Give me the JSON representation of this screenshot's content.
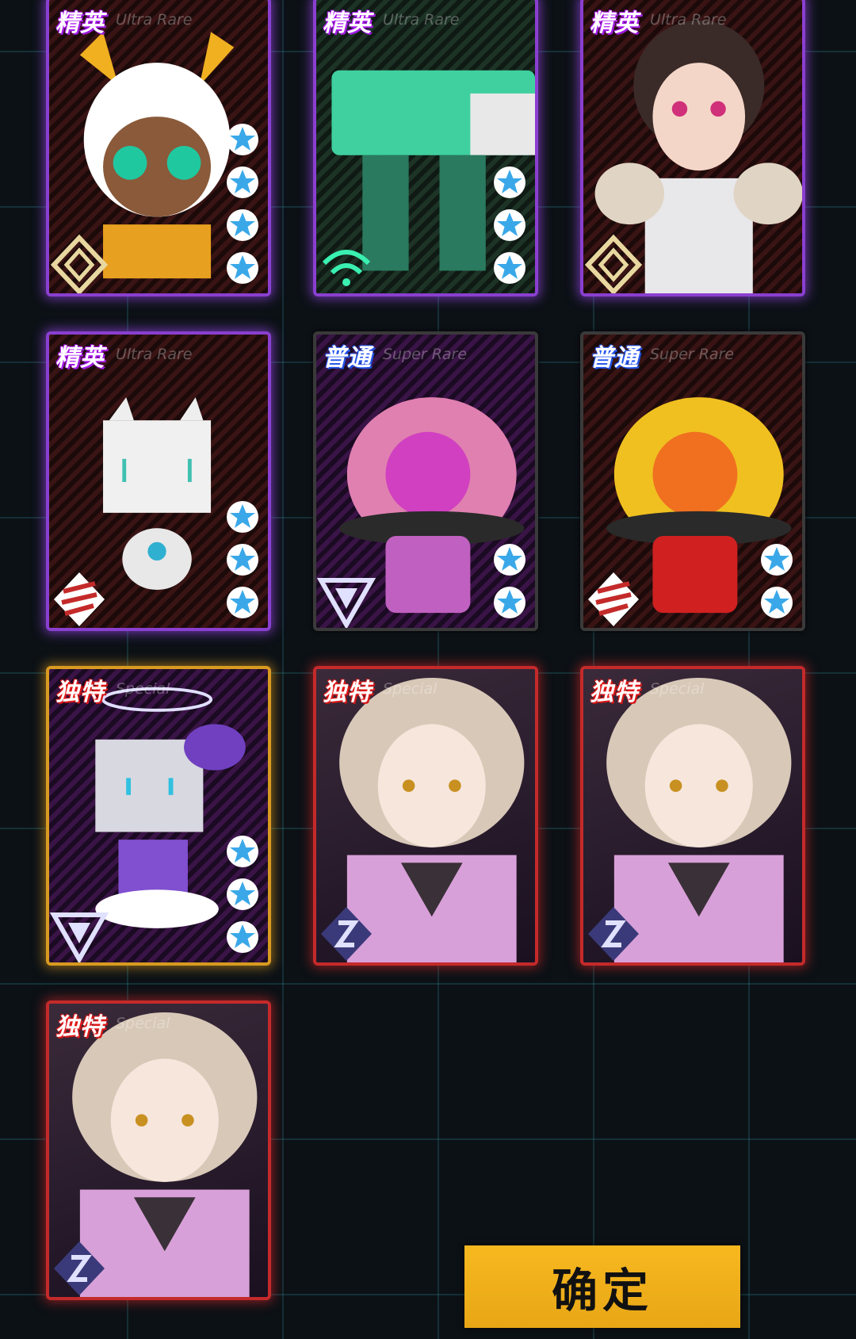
{
  "cards": [
    {
      "rarity_label": "精英",
      "rarity_sub": "Ultra Rare",
      "stars": 4
    },
    {
      "rarity_label": "精英",
      "rarity_sub": "Ultra Rare",
      "stars": 3
    },
    {
      "rarity_label": "精英",
      "rarity_sub": "Ultra Rare",
      "stars": 0
    },
    {
      "rarity_label": "精英",
      "rarity_sub": "Ultra Rare",
      "stars": 3
    },
    {
      "rarity_label": "普通",
      "rarity_sub": "Super Rare",
      "stars": 2
    },
    {
      "rarity_label": "普通",
      "rarity_sub": "Super Rare",
      "stars": 2
    },
    {
      "rarity_label": "独特",
      "rarity_sub": "Special",
      "stars": 3
    },
    {
      "rarity_label": "独特",
      "rarity_sub": "Special",
      "stars": 0
    },
    {
      "rarity_label": "独特",
      "rarity_sub": "Special",
      "stars": 0
    },
    {
      "rarity_label": "独特",
      "rarity_sub": "Special",
      "stars": 0
    }
  ],
  "confirm_button": {
    "label": "确定"
  },
  "colors": {
    "elite": "#8a3fd0",
    "unique": "#c42a2a",
    "gold": "#d89a20",
    "button": "#f0ae1a"
  }
}
